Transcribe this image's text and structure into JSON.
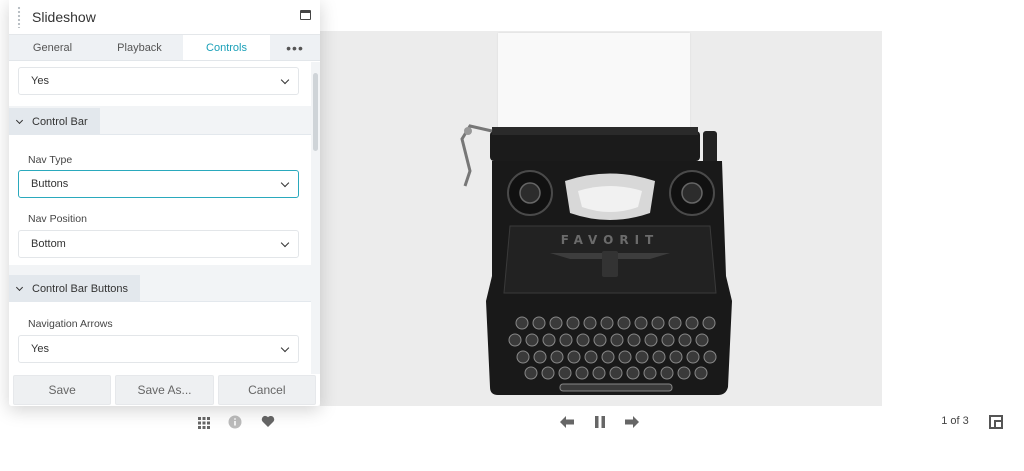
{
  "panel": {
    "title": "Slideshow",
    "tabs": [
      {
        "label": "General"
      },
      {
        "label": "Playback"
      },
      {
        "label": "Controls"
      }
    ],
    "more_label": "•••",
    "top_select": {
      "value": "Yes"
    },
    "sections": [
      {
        "title": "Control Bar",
        "fields": [
          {
            "label": "Nav Type",
            "value": "Buttons"
          },
          {
            "label": "Nav Position",
            "value": "Bottom"
          }
        ]
      },
      {
        "title": "Control Bar Buttons",
        "fields": [
          {
            "label": "Navigation Arrows",
            "value": "Yes"
          }
        ]
      }
    ],
    "footer": {
      "save": "Save",
      "save_as": "Save As...",
      "cancel": "Cancel"
    }
  },
  "controls": {
    "left_icons": [
      "grid-icon",
      "info-icon",
      "heart-icon"
    ],
    "center_icons": [
      "arrow-left-icon",
      "pause-icon",
      "arrow-right-icon"
    ],
    "counter": "1 of 3",
    "right_icon": "fullscreen-icon"
  },
  "slide": {
    "image": "typewriter-photo",
    "brand_text": "FAVORIT"
  }
}
